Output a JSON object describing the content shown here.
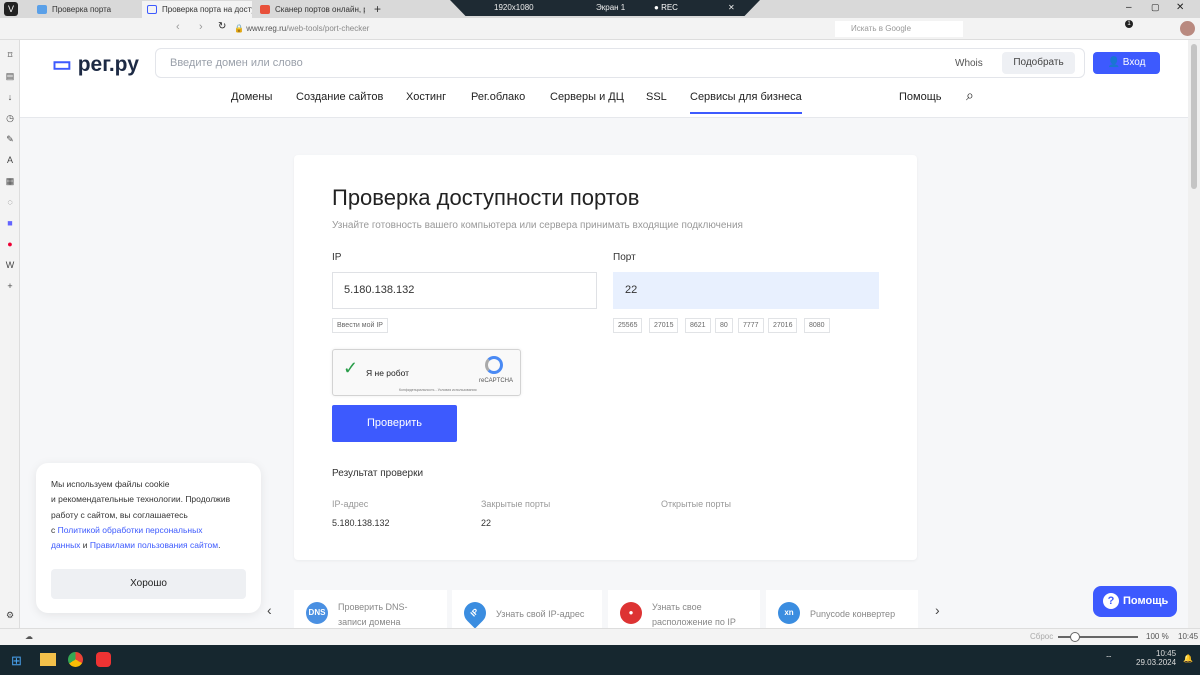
{
  "browser": {
    "tabs": [
      "Проверка порта",
      "Проверка порта на доступ",
      "Сканер портов онлайн, ро"
    ],
    "new_tab": "+",
    "recorder": {
      "resolution": "1920x1080",
      "screen": "Экран 1",
      "rec": "REC"
    },
    "url_domain": "www.reg.ru",
    "url_path": "/web-tools/port-checker",
    "search_placeholder": "Искать в Google",
    "badge": "1"
  },
  "site": {
    "logo": "рег.ру",
    "search_placeholder": "Введите домен или слово",
    "whois": "Whois",
    "pick": "Подобрать",
    "login": "Вход",
    "nav": [
      "Домены",
      "Создание сайтов",
      "Хостинг",
      "Рег.облако",
      "Серверы и ДЦ",
      "SSL",
      "Сервисы для бизнеса"
    ],
    "help_link": "Помощь"
  },
  "checker": {
    "title": "Проверка доступности портов",
    "subtitle": "Узнайте готовность вашего компьютера или сервера принимать входящие подключения",
    "ip_label": "IP",
    "ip_value": "5.180.138.132",
    "my_ip": "Ввести мой IP",
    "port_label": "Порт",
    "port_value": "22",
    "ports": [
      "25565",
      "27015",
      "8621",
      "80",
      "7777",
      "27016",
      "8080"
    ],
    "captcha": {
      "label": "Я не робот",
      "brand": "reCAPTCHA",
      "terms": "Конфиденциальность - Условия использования"
    },
    "submit": "Проверить",
    "result_title": "Результат проверки",
    "result": {
      "ip_label": "IP-адрес",
      "ip": "5.180.138.132",
      "closed_label": "Закрытые порты",
      "closed": "22",
      "open_label": "Открытые порты"
    }
  },
  "cookie": {
    "t1": "Мы используем файлы cookie",
    "t2": "и рекомендательные технологии. Продолжив",
    "t3": "работу с сайтом, вы соглашаетесь",
    "t4": "с ",
    "link1a": "Политикой обработки персональных",
    "link1b": "данных",
    "and": " и ",
    "link2": "Правилами пользования сайтом",
    "dot": ".",
    "ok": "Хорошо"
  },
  "tools": [
    {
      "icon": "DNS",
      "label": "Проверить DNS-записи домена"
    },
    {
      "icon": "IP",
      "label": "Узнать свой IP-адрес"
    },
    {
      "icon": "●",
      "label": "Узнать свое расположение по IP"
    },
    {
      "icon": "xn",
      "label": "Punycode конвертер"
    }
  ],
  "help_button": "Помощь",
  "status": {
    "reset": "Сброс",
    "zoom": "100 %",
    "time": "10:45"
  },
  "taskbar": {
    "time": "10:45",
    "date": "29.03.2024"
  },
  "colors": {
    "accent": "#3d5afe",
    "port_bg": "#e8f0fe"
  }
}
